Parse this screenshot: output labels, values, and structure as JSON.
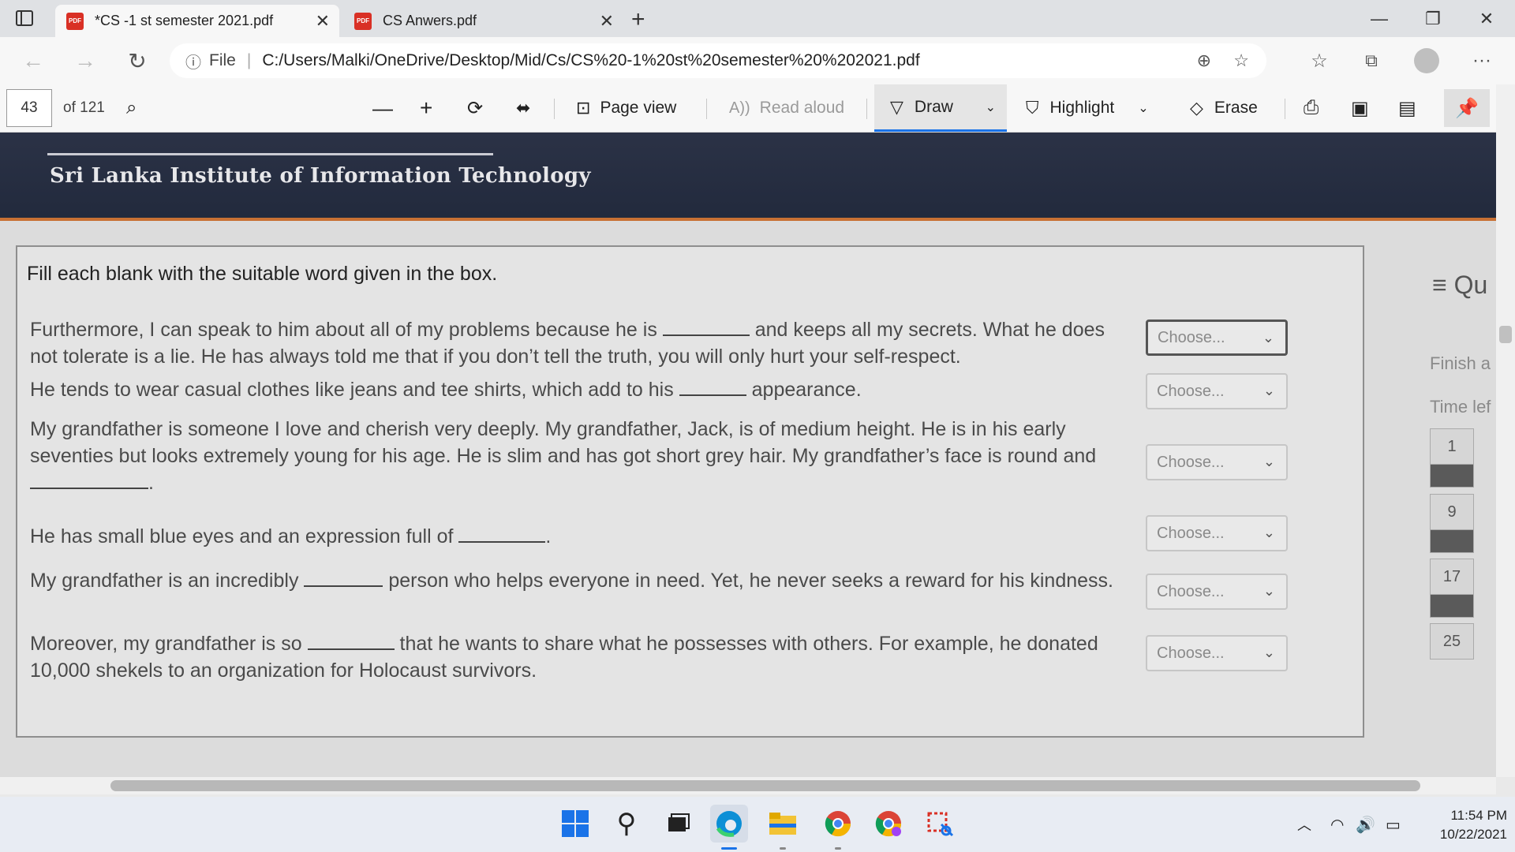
{
  "browser": {
    "tabs": [
      {
        "title": "*CS -1 st semester 2021.pdf",
        "icon": "pdf-icon",
        "active": true
      },
      {
        "title": "CS Anwers.pdf",
        "icon": "pdf-icon",
        "active": false
      }
    ],
    "new_tab_label": "+",
    "address": {
      "prefix": "File",
      "url": "C:/Users/Malki/OneDrive/Desktop/Mid/Cs/CS%20-1%20st%20semester%20%202021.pdf"
    }
  },
  "pdf_toolbar": {
    "page_number": "43",
    "page_total": "of 121",
    "page_view": "Page view",
    "read_aloud": "Read aloud",
    "draw": "Draw",
    "highlight": "Highlight",
    "erase": "Erase"
  },
  "document": {
    "banner_title": "Sri Lanka Institute of Information Technology",
    "instruction": "Fill each blank with the suitable word given in the box.",
    "questions": [
      {
        "before": "Furthermore, I can speak to him about all of my problems because he is",
        "after": "and keeps all my secrets. What he does not tolerate is a lie. He has always told me that if you don’t tell the truth, you will only hurt your self-respect.",
        "select": "Choose..."
      },
      {
        "before": "He tends to wear casual clothes like jeans and tee shirts, which add to his",
        "after": "appearance.",
        "select": "Choose..."
      },
      {
        "before": "My grandfather is someone I love and cherish very deeply. My grandfather, Jack, is of medium height. He is in his early seventies but looks extremely young for his age. He is slim and has got short grey hair. My grandfather’s face is round and",
        "after": ".",
        "select": "Choose..."
      },
      {
        "before": "He has small blue eyes and an expression full of",
        "after": ".",
        "select": "Choose..."
      },
      {
        "before": "My grandfather is an incredibly",
        "after": "person who helps everyone in need. Yet, he never seeks a reward for his kindness.",
        "select": "Choose..."
      },
      {
        "before": "Moreover, my grandfather is so",
        "after": "that he wants to share what he possesses with others. For example, he donated 10,000 shekels to an organization for Holocaust survivors.",
        "select": "Choose..."
      }
    ],
    "side_panel": {
      "menu": "≡ Qu",
      "finish": "Finish a",
      "time": "Time lef",
      "nav": [
        "1",
        "9",
        "17",
        "25"
      ]
    }
  },
  "taskbar": {
    "time": "11:54 PM",
    "date": "10/22/2021"
  },
  "colors": {
    "banner": "#252c40",
    "accent_orange": "#c87134",
    "draw_underline": "#1a73e8"
  }
}
